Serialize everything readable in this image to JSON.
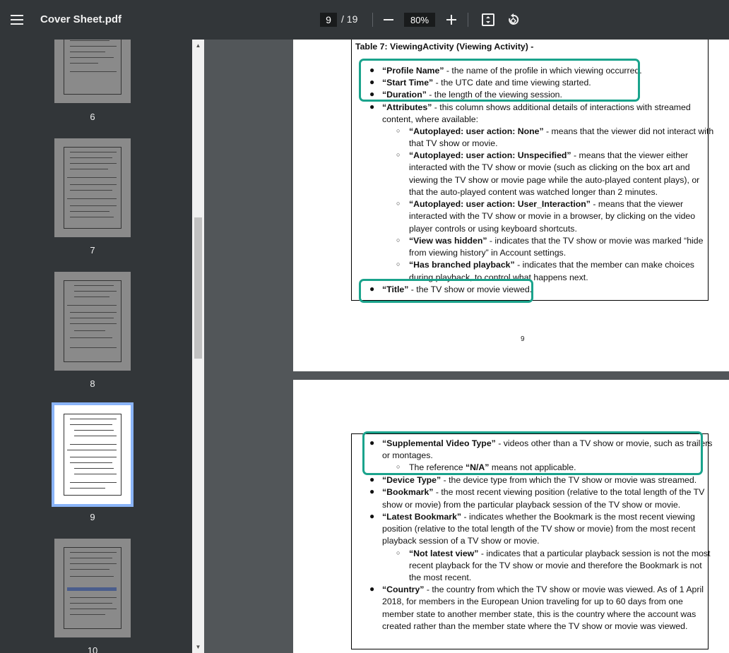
{
  "toolbar": {
    "title": "Cover Sheet.pdf",
    "current_page": "9",
    "total_pages": "/ 19",
    "zoom": "80%"
  },
  "icons": {
    "menu": "menu-icon",
    "zoom_out": "minus-icon",
    "zoom_in": "plus-icon",
    "fit": "fit-page-icon",
    "rotate": "rotate-icon"
  },
  "thumbnails": [
    {
      "label": "6"
    },
    {
      "label": "7"
    },
    {
      "label": "8"
    },
    {
      "label": "9"
    },
    {
      "label": "10"
    }
  ],
  "page9": {
    "heading": "Table 7: ViewingActivity (Viewing Activity) -",
    "items": [
      {
        "b": "“Profile Name”",
        "t": " - the name of the profile in which viewing occurred."
      },
      {
        "b": "“Start Time”",
        "t": " - the UTC date and time viewing started."
      },
      {
        "b": "“Duration”",
        "t": " - the length of the viewing session."
      },
      {
        "b": "“Attributes”",
        "t": " - this column shows additional details of interactions with streamed",
        "t2": "content, where available:"
      },
      {
        "b": "“Title”",
        "t": " - the TV show or movie viewed."
      }
    ],
    "sub": [
      {
        "b": "“Autoplayed: user action: None”",
        "t": " - means that the viewer did not interact with",
        "lines": [
          "that TV show or movie."
        ]
      },
      {
        "b": "“Autoplayed: user action: Unspecified”",
        "t": " - means that the viewer either",
        "lines": [
          "interacted with the TV show or movie (such as clicking on the box art and",
          "viewing the TV show or movie page while the auto-played content plays), or",
          "that the auto-played content was watched longer than 2 minutes."
        ]
      },
      {
        "b": "“Autoplayed: user action: User_Interaction”",
        "t": " - means that the viewer",
        "lines": [
          "interacted with the TV show or movie in a browser, by clicking on the video",
          "player controls or using keyboard shortcuts."
        ]
      },
      {
        "b": "“View was hidden”",
        "t": " - indicates that the TV show or movie was marked “hide",
        "lines": [
          "from viewing history” in Account settings."
        ]
      },
      {
        "b": "“Has branched playback”",
        "t": " - indicates that the member can make choices",
        "lines": [
          "during playback, to control what happens next."
        ]
      }
    ],
    "page_number": "9"
  },
  "page10": {
    "items": [
      {
        "b": "“Supplemental Video Type”",
        "t": " - videos other than a TV show or movie, such as trailers",
        "lines": [
          "or montages."
        ]
      },
      {
        "b": "“Device Type”",
        "t": " - the device type from which the TV show or movie was streamed.",
        "lines": []
      },
      {
        "b": "“Bookmark”",
        "t": " - the most recent viewing position (relative to the total length of the TV",
        "lines": [
          "show or movie) from the particular playback session of the TV show or movie."
        ]
      },
      {
        "b": "“Latest Bookmark”",
        "t": " - indicates whether the Bookmark is the most recent viewing",
        "lines": [
          "position (relative to the total length of the TV show or movie) from the most recent",
          "playback session of a TV show or movie."
        ]
      },
      {
        "b": "“Country”",
        "t": " - the country from which the TV show or movie was viewed. As of 1 April",
        "lines": [
          "2018, for members in the European Union traveling for up to 60 days from one",
          "member state to another member state, this is the country where the account was",
          "created rather than the member state where the TV show or movie was viewed."
        ]
      }
    ],
    "sub_na": {
      "pre": "The reference ",
      "b": "“N/A”",
      "t": " means not applicable."
    },
    "sub_latest": {
      "b": "“Not latest view”",
      "t": " - indicates that a particular playback session is not the most",
      "lines": [
        "recent playback for the TV show or movie and therefore the Bookmark is not",
        "the most recent."
      ]
    }
  }
}
